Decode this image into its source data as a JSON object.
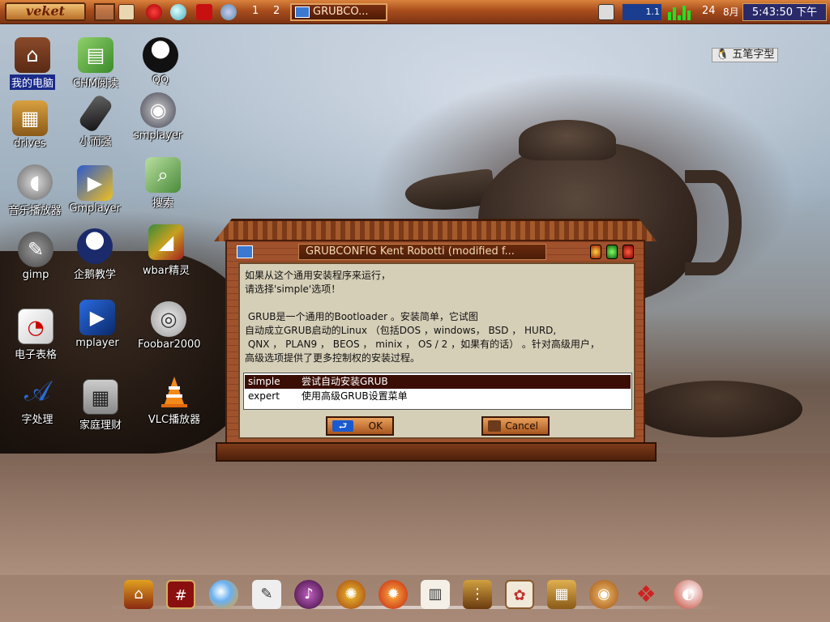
{
  "taskbar": {
    "start_label": "veket",
    "workspace_1": "1",
    "workspace_2": "2",
    "task_title": "GRUBCO...",
    "tray_value": "1.1",
    "tray_extra": "24",
    "date_short": "8月",
    "clock": "5:43:50 下午"
  },
  "ime": {
    "label": "五笔字型"
  },
  "desktop": {
    "icons": [
      {
        "label": "我的电脑",
        "icon": "home-icon"
      },
      {
        "label": "CHM阅读",
        "icon": "book-icon"
      },
      {
        "label": "QQ",
        "icon": "penguin-icon"
      },
      {
        "label": "drives",
        "icon": "drive-icon"
      },
      {
        "label": "小而强",
        "icon": "usb-icon"
      },
      {
        "label": "smplayer",
        "icon": "film-reel-icon"
      },
      {
        "label": "音乐播放器",
        "icon": "speaker-icon"
      },
      {
        "label": "Gmplayer",
        "icon": "clapper-icon"
      },
      {
        "label": "搜索",
        "icon": "search-icon"
      },
      {
        "label": "gimp",
        "icon": "gimp-icon"
      },
      {
        "label": "企鹅教学",
        "icon": "headset-penguin-icon"
      },
      {
        "label": "wbar精灵",
        "icon": "wbar-icon"
      },
      {
        "label": "电子表格",
        "icon": "spreadsheet-icon"
      },
      {
        "label": "mplayer",
        "icon": "media-icon"
      },
      {
        "label": "Foobar2000",
        "icon": "speakers-icon"
      },
      {
        "label": "字处理",
        "icon": "writer-icon"
      },
      {
        "label": "家庭理财",
        "icon": "calculator-icon"
      },
      {
        "label": "VLC播放器",
        "icon": "vlc-cone-icon"
      }
    ]
  },
  "dialog": {
    "title": "GRUBCONFIG Kent Robotti (modified f...",
    "message": "如果从这个通用安装程序来运行，\n请选择'simple'选项！\n\n GRUB是一个通用的Bootloader 。安装简单，它试图\n自动成立GRUB启动的Linux （包括DOS ，windows， BSD ， HURD,\n QNX ， PLAN9 ， BEOS ， minix ， OS / 2 ，如果有的话） 。针对高级用户，\n高级选项提供了更多控制权的安装过程。",
    "options": [
      {
        "key": "simple",
        "desc": "尝试自动安装GRUB",
        "selected": true
      },
      {
        "key": "expert",
        "desc": "使用高级GRUB设置菜单",
        "selected": false
      }
    ],
    "ok_label": "OK",
    "cancel_label": "Cancel"
  },
  "dock": {
    "icons": [
      "palace-icon",
      "terminal-icon",
      "globe-icon",
      "notes-icon",
      "media-player-icon",
      "settings-icon",
      "fire-icon",
      "calendar-icon",
      "abacus-icon",
      "picture-icon",
      "package-icon",
      "food-icon",
      "knot-icon",
      "exit-icon"
    ]
  }
}
